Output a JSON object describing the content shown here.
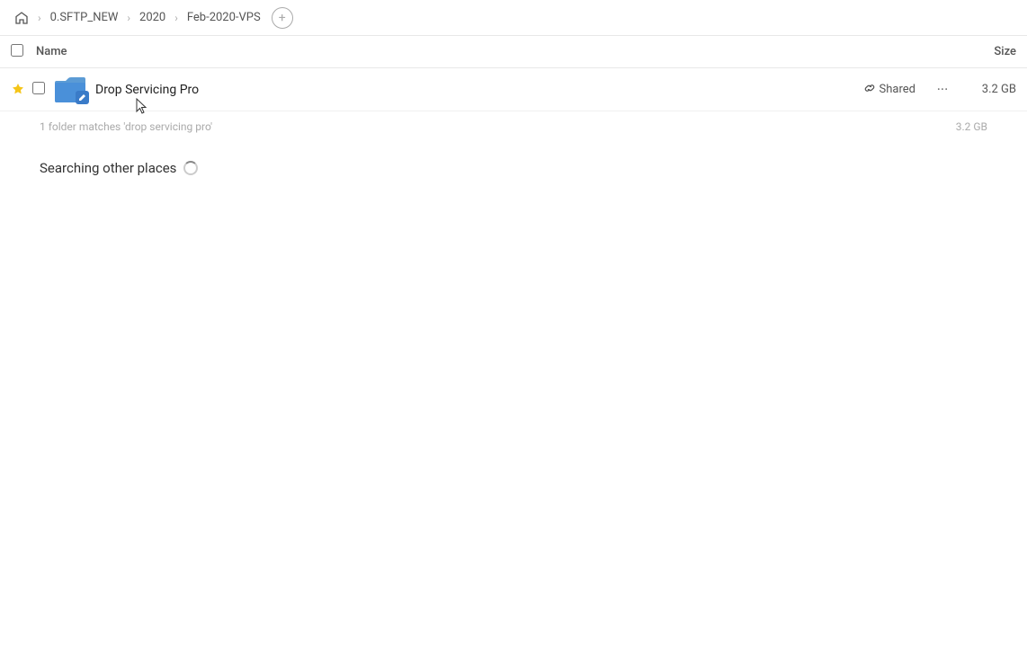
{
  "breadcrumb": {
    "home_icon": "🏠",
    "items": [
      {
        "label": "0.SFTP_NEW",
        "id": "sftp"
      },
      {
        "label": "2020",
        "id": "2020"
      },
      {
        "label": "Feb-2020-VPS",
        "id": "feb2020vps"
      }
    ],
    "add_icon": "+"
  },
  "table": {
    "name_header": "Name",
    "size_header": "Size"
  },
  "file_row": {
    "name": "Drop Servicing Pro",
    "shared_label": "Shared",
    "size": "3.2 GB"
  },
  "matches": {
    "text": "1 folder matches 'drop servicing pro'",
    "size": "3.2 GB"
  },
  "searching": {
    "label": "Searching other places"
  }
}
